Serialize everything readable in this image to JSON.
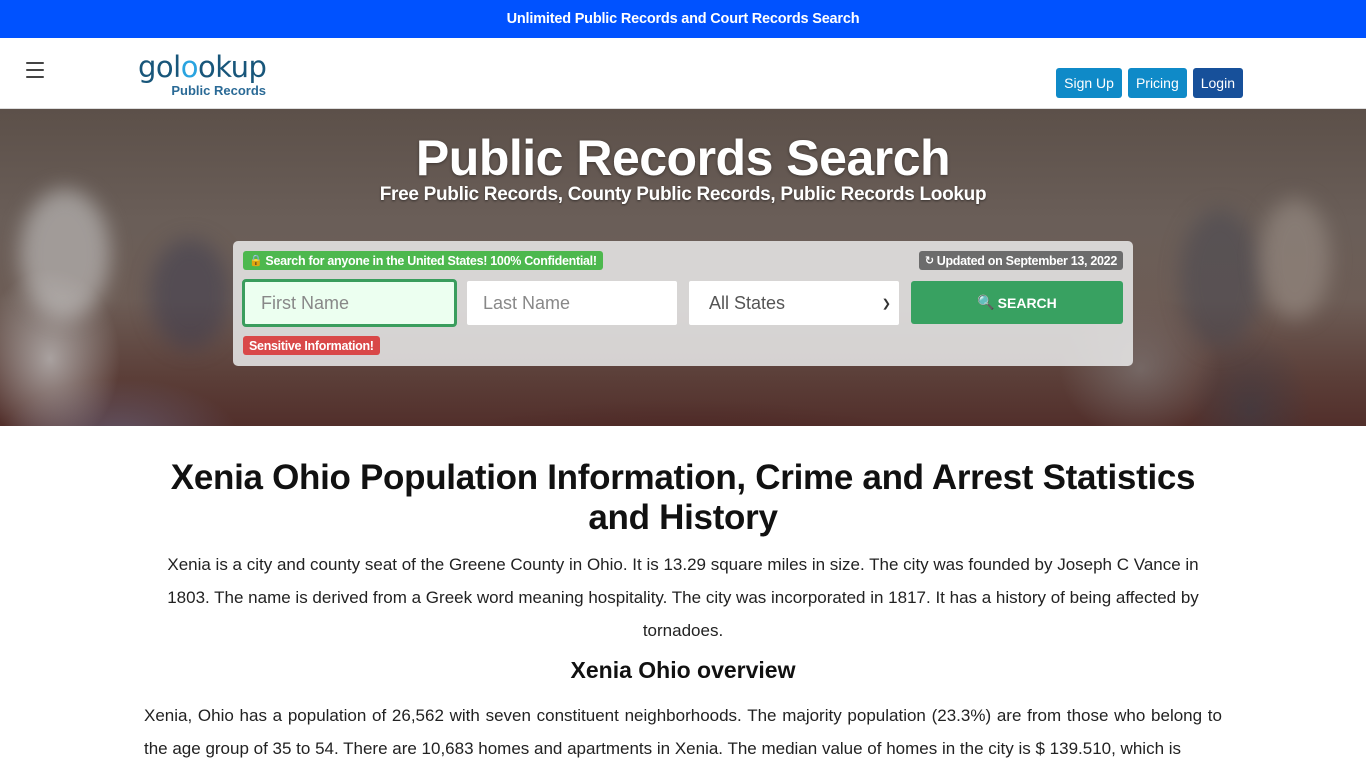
{
  "topbar": {
    "text": "Unlimited Public Records and Court Records Search"
  },
  "navbar": {
    "logo_main_a": "gol",
    "logo_ring": "o",
    "logo_main_b": "okup",
    "logo_sub": "Public Records",
    "buttons": {
      "signup": "Sign Up",
      "pricing": "Pricing",
      "login": "Login"
    }
  },
  "hero": {
    "title": "Public Records Search",
    "subtitle": "Free Public Records, County Public Records, Public Records Lookup"
  },
  "search": {
    "confidential_badge": "Search for anyone in the United States! 100% Confidential!",
    "updated_badge": "Updated on September 13, 2022",
    "first_name_placeholder": "First Name",
    "last_name_placeholder": "Last Name",
    "state_selected": "All States",
    "search_button": "SEARCH",
    "sensitive_badge": "Sensitive Information!",
    "icons": {
      "lock": "lock-icon",
      "refresh": "refresh-icon",
      "search": "search-icon"
    }
  },
  "article": {
    "title": "Xenia Ohio Population Information, Crime and Arrest Statistics and History",
    "intro": "Xenia is a city and county seat of the Greene County in Ohio. It is 13.29 square miles in size. The city was founded by Joseph C Vance in 1803. The name is derived from a Greek word meaning hospitality. The city was incorporated in 1817. It has a history of being affected by tornadoes.",
    "overview_title": "Xenia Ohio overview",
    "overview_text": "Xenia, Ohio has a population of 26,562 with seven constituent neighborhoods. The majority population (23.3%) are from those who belong to the age group of 35 to 54. There are 10,683 homes and apartments in Xenia. The median value of homes in the city is $ 139.510, which is"
  },
  "colors": {
    "topbar": "#0052ff",
    "signup": "#0f8ac8",
    "login": "#17509a",
    "search_button": "#38a161",
    "confidential_badge": "#4db84e",
    "sensitive_badge": "#d94848",
    "updated_badge": "#6c6c6c"
  }
}
